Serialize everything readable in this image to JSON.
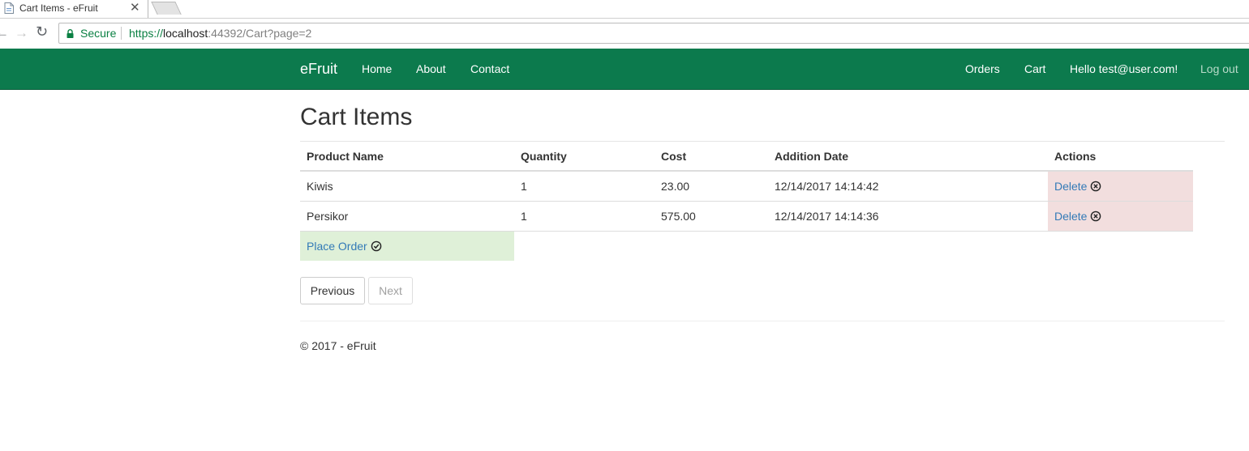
{
  "browser": {
    "tab_title": "Cart Items - eFruit",
    "tab_close": "✕",
    "security_label": "Secure",
    "url_protocol": "https://",
    "url_host": "localhost",
    "url_rest": ":44392/Cart?page=2"
  },
  "navbar": {
    "brand": "eFruit",
    "left_links": [
      "Home",
      "About",
      "Contact"
    ],
    "right_links": [
      "Orders",
      "Cart"
    ],
    "greeting": "Hello test@user.com!",
    "logout": "Log out",
    "background_color": "#0c7a4d"
  },
  "page": {
    "title": "Cart Items"
  },
  "table": {
    "headers": [
      "Product Name",
      "Quantity",
      "Cost",
      "Addition Date",
      "Actions"
    ],
    "rows": [
      {
        "product": "Kiwis",
        "quantity": "1",
        "cost": "23.00",
        "date": "12/14/2017 14:14:42",
        "action": "Delete",
        "action_icon": "circle-x-icon"
      },
      {
        "product": "Persikor",
        "quantity": "1",
        "cost": "575.00",
        "date": "12/14/2017 14:14:36",
        "action": "Delete",
        "action_icon": "circle-x-icon"
      }
    ],
    "place_order": "Place Order",
    "place_order_icon": "circle-check-icon"
  },
  "pager": {
    "previous": "Previous",
    "next": "Next",
    "next_disabled": true
  },
  "footer": {
    "text": "© 2017 - eFruit"
  },
  "colors": {
    "link": "#337ab7",
    "danger_bg": "#f2dede",
    "success_bg": "#dff0d8",
    "secure_green": "#0b8043"
  }
}
